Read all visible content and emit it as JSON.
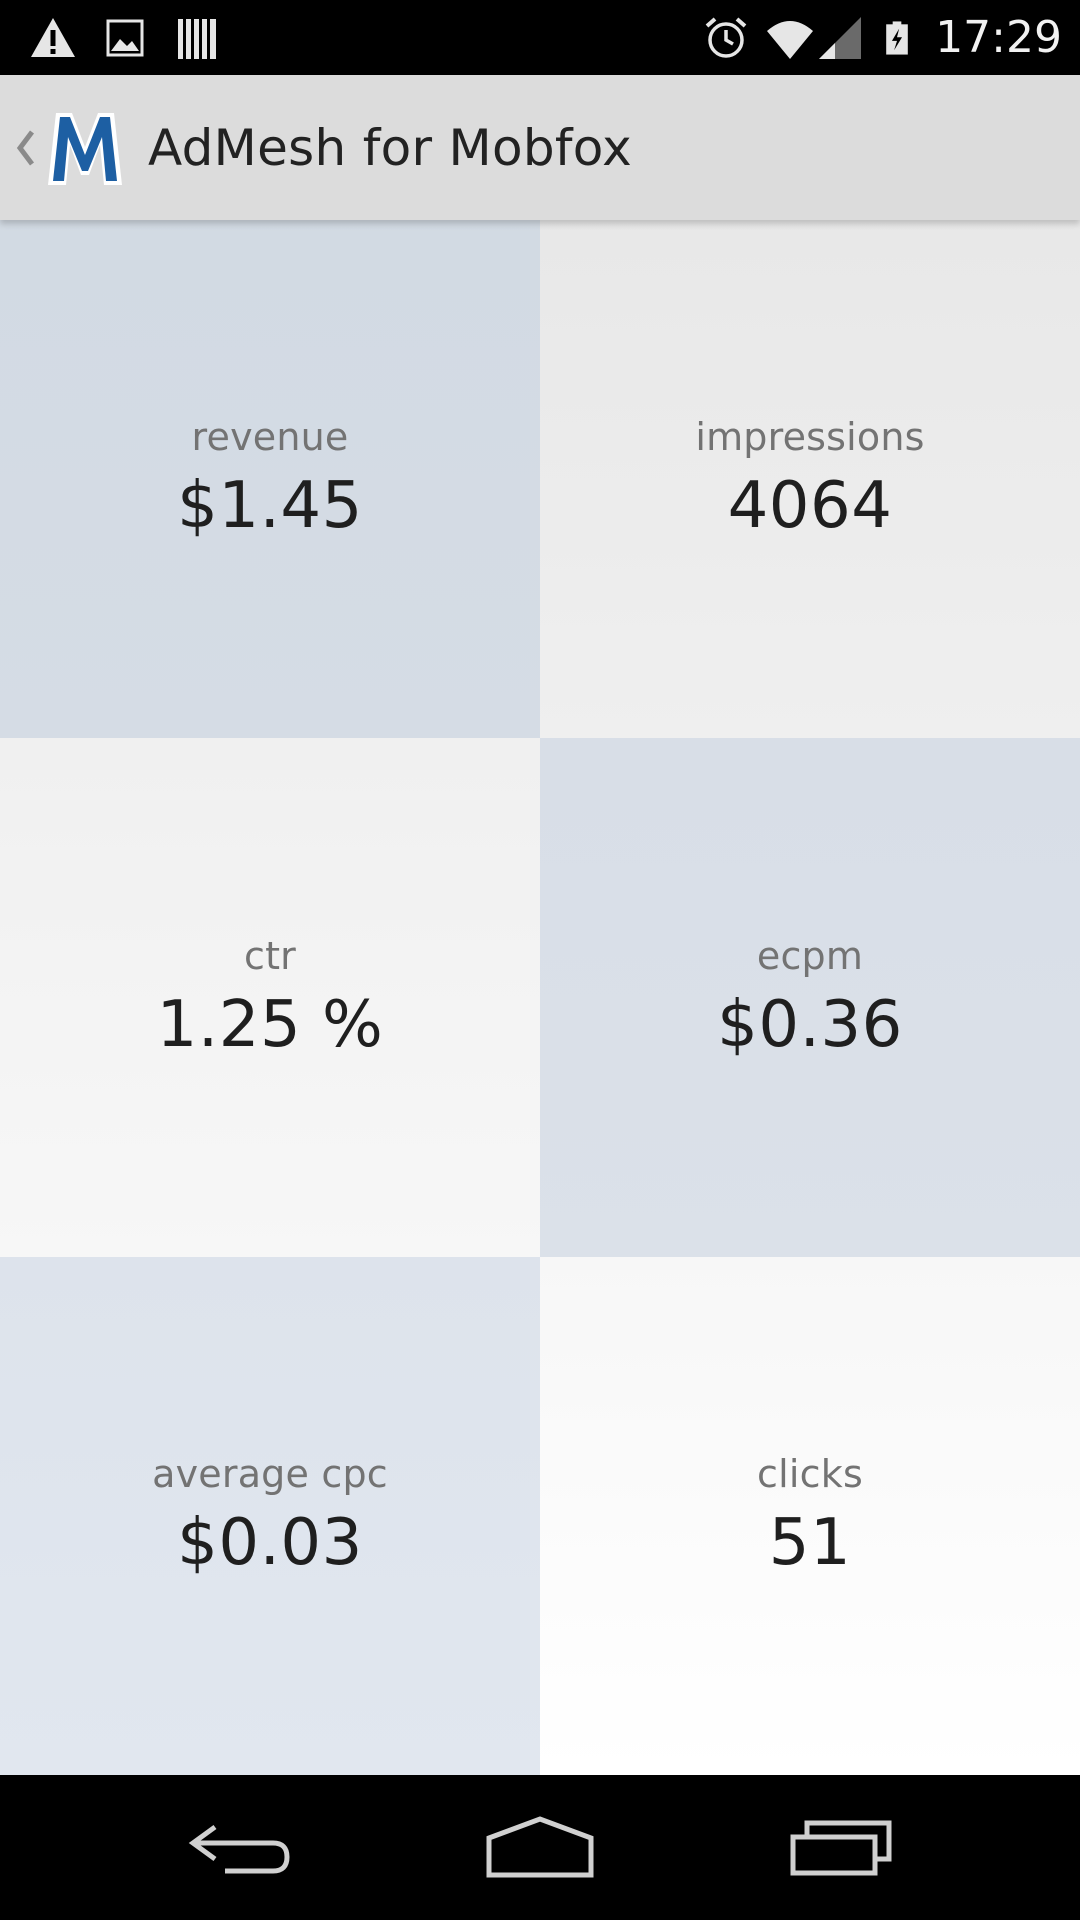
{
  "status_bar": {
    "time": "17:29",
    "left_icons": [
      "warning-icon",
      "image-icon",
      "barcode-icon"
    ],
    "right_icons": [
      "alarm-icon",
      "wifi-icon",
      "cell-signal-icon",
      "battery-charging-icon"
    ]
  },
  "action_bar": {
    "title": "AdMesh for Mobfox",
    "logo_letter": "M",
    "logo_color": "#1d5fa3"
  },
  "metrics": [
    {
      "label": "revenue",
      "value": "$1.45"
    },
    {
      "label": "impressions",
      "value": "4064"
    },
    {
      "label": "ctr",
      "value": "1.25 %"
    },
    {
      "label": "ecpm",
      "value": "$0.36"
    },
    {
      "label": "average cpc",
      "value": "$0.03"
    },
    {
      "label": "clicks",
      "value": "51"
    }
  ],
  "nav_bar": {
    "buttons": [
      "back-icon",
      "home-icon",
      "recent-apps-icon"
    ]
  }
}
